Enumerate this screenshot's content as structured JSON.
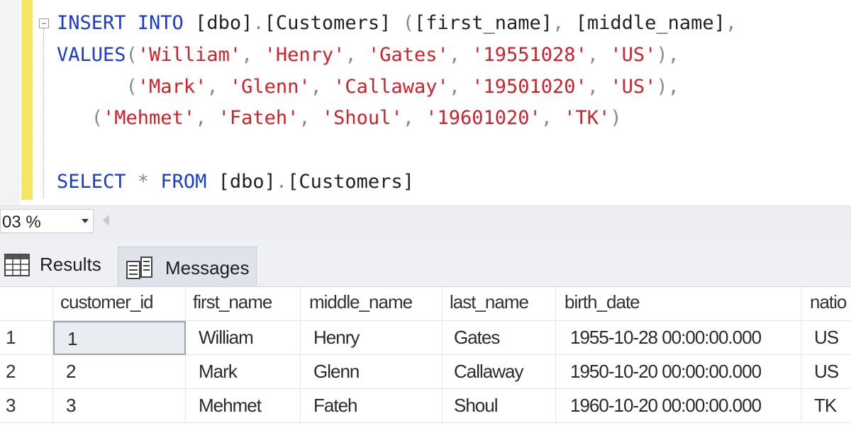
{
  "editor": {
    "lines": [
      [
        {
          "t": "INSERT INTO ",
          "c": "kw"
        },
        {
          "t": "[dbo]",
          "c": "plain"
        },
        {
          "t": ".",
          "c": "op"
        },
        {
          "t": "[Customers] ",
          "c": "plain"
        },
        {
          "t": "(",
          "c": "op"
        },
        {
          "t": "[first_name]",
          "c": "plain"
        },
        {
          "t": ", ",
          "c": "op"
        },
        {
          "t": "[middle_name]",
          "c": "plain"
        },
        {
          "t": ",",
          "c": "op"
        }
      ],
      [
        {
          "t": "VALUES",
          "c": "kw"
        },
        {
          "t": "(",
          "c": "op"
        },
        {
          "t": "'William'",
          "c": "str"
        },
        {
          "t": ", ",
          "c": "op"
        },
        {
          "t": "'Henry'",
          "c": "str"
        },
        {
          "t": ", ",
          "c": "op"
        },
        {
          "t": "'Gates'",
          "c": "str"
        },
        {
          "t": ", ",
          "c": "op"
        },
        {
          "t": "'19551028'",
          "c": "str"
        },
        {
          "t": ", ",
          "c": "op"
        },
        {
          "t": "'US'",
          "c": "str"
        },
        {
          "t": "),",
          "c": "op"
        }
      ],
      [
        {
          "t": "      (",
          "c": "op"
        },
        {
          "t": "'Mark'",
          "c": "str"
        },
        {
          "t": ", ",
          "c": "op"
        },
        {
          "t": "'Glenn'",
          "c": "str"
        },
        {
          "t": ", ",
          "c": "op"
        },
        {
          "t": "'Callaway'",
          "c": "str"
        },
        {
          "t": ", ",
          "c": "op"
        },
        {
          "t": "'19501020'",
          "c": "str"
        },
        {
          "t": ", ",
          "c": "op"
        },
        {
          "t": "'US'",
          "c": "str"
        },
        {
          "t": "),",
          "c": "op"
        }
      ],
      [
        {
          "t": "   (",
          "c": "op"
        },
        {
          "t": "'Mehmet'",
          "c": "str"
        },
        {
          "t": ", ",
          "c": "op"
        },
        {
          "t": "'Fateh'",
          "c": "str"
        },
        {
          "t": ", ",
          "c": "op"
        },
        {
          "t": "'Shoul'",
          "c": "str"
        },
        {
          "t": ", ",
          "c": "op"
        },
        {
          "t": "'19601020'",
          "c": "str"
        },
        {
          "t": ", ",
          "c": "op"
        },
        {
          "t": "'TK'",
          "c": "str"
        },
        {
          "t": ")",
          "c": "op"
        }
      ],
      [],
      [
        {
          "t": "SELECT ",
          "c": "kw"
        },
        {
          "t": "* ",
          "c": "op"
        },
        {
          "t": "FROM ",
          "c": "kw"
        },
        {
          "t": "[dbo]",
          "c": "plain"
        },
        {
          "t": ".",
          "c": "op"
        },
        {
          "t": "[Customers]",
          "c": "plain"
        }
      ]
    ]
  },
  "zoom": {
    "value": "03 %"
  },
  "tabs": {
    "results": "Results",
    "messages": "Messages"
  },
  "grid": {
    "columns": [
      "customer_id",
      "first_name",
      "middle_name",
      "last_name",
      "birth_date",
      "natio"
    ],
    "rows": [
      {
        "num": "1",
        "cells": [
          "1",
          "William",
          "Henry",
          "Gates",
          "1955-10-28 00:00:00.000",
          "US"
        ]
      },
      {
        "num": "2",
        "cells": [
          "2",
          "Mark",
          "Glenn",
          "Callaway",
          "1950-10-20 00:00:00.000",
          "US"
        ]
      },
      {
        "num": "3",
        "cells": [
          "3",
          "Mehmet",
          "Fateh",
          "Shoul",
          "1960-10-20 00:00:00.000",
          "TK"
        ]
      }
    ]
  },
  "colors": {
    "keyword": "#1a3bd0",
    "string": "#d2202a",
    "change_bar": "#f5e663",
    "selected_cell": "#e9ecf0"
  }
}
